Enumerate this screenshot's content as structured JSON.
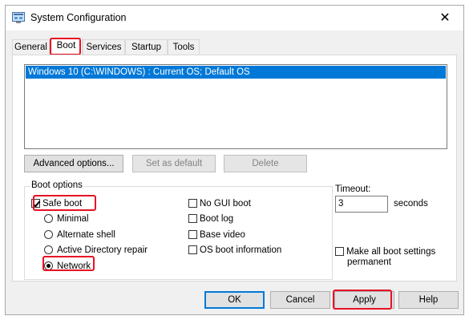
{
  "window": {
    "title": "System Configuration",
    "close_glyph": "✕"
  },
  "tabs": [
    {
      "label": "General"
    },
    {
      "label": "Boot"
    },
    {
      "label": "Services"
    },
    {
      "label": "Startup"
    },
    {
      "label": "Tools"
    }
  ],
  "active_tab": "Boot",
  "os_list": {
    "items": [
      "Windows 10 (C:\\WINDOWS) : Current OS; Default OS"
    ]
  },
  "buttons": {
    "advanced_options": "Advanced options...",
    "set_default": "Set as default",
    "delete": "Delete",
    "ok": "OK",
    "cancel": "Cancel",
    "apply": "Apply",
    "help": "Help"
  },
  "boot_options": {
    "label": "Boot options",
    "safe_boot": {
      "label": "Safe boot",
      "checked": true
    },
    "minimal": {
      "label": "Minimal",
      "selected": false
    },
    "alternate_shell": {
      "label": "Alternate shell",
      "selected": false
    },
    "ad_repair": {
      "label": "Active Directory repair",
      "selected": false
    },
    "network": {
      "label": "Network",
      "selected": true
    },
    "no_gui_boot": {
      "label": "No GUI boot",
      "checked": false
    },
    "boot_log": {
      "label": "Boot log",
      "checked": false
    },
    "base_video": {
      "label": "Base video",
      "checked": false
    },
    "os_boot_info": {
      "label": "OS boot information",
      "checked": false
    }
  },
  "timeout": {
    "label": "Timeout:",
    "value": "3",
    "unit": "seconds"
  },
  "make_permanent": {
    "line1": "Make all boot settings",
    "line2": "permanent",
    "checked": false
  },
  "highlight_color": "#e81123",
  "accent_color": "#0078d7"
}
